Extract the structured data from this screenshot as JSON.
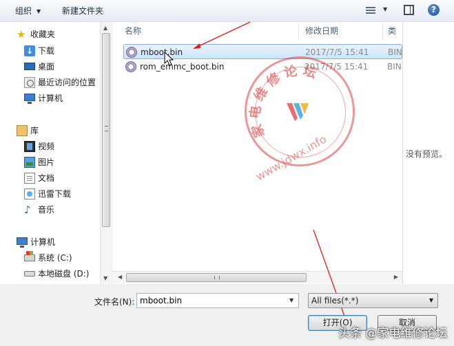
{
  "toolbar": {
    "organize_label": "组织",
    "new_folder_label": "新建文件夹",
    "help_glyph": "?"
  },
  "nav": {
    "favorites": {
      "title": "收藏夹",
      "items": [
        "下载",
        "桌面",
        "最近访问的位置"
      ]
    },
    "computer_group_1": "计算机",
    "libraries": {
      "title": "库",
      "items": [
        "视频",
        "图片",
        "文档",
        "迅雷下载",
        "音乐"
      ]
    },
    "computer": {
      "title": "计算机",
      "items": [
        "系统 (C:)",
        "本地磁盘 (D:)"
      ]
    }
  },
  "file_list": {
    "columns": {
      "name": "名称",
      "date": "修改日期",
      "type": "类型"
    },
    "rows": [
      {
        "name": "mboot.bin",
        "date": "2017/7/5 15:41",
        "type": "BIN"
      },
      {
        "name": "rom_emmc_boot.bin",
        "date": "2017/7/5 15:41",
        "type": "BIN"
      }
    ]
  },
  "preview": {
    "message": "没有预览。"
  },
  "bottom": {
    "filename_label": "文件名(N):",
    "filename_value": "mboot.bin",
    "filter_value": "All files(*.*)",
    "open_label": "打开(O)",
    "cancel_label": "取消"
  },
  "watermark": {
    "circle_text": "家电维修论坛",
    "url": "www.jdwx.info",
    "bottom_caption": "头条 @家电维修论坛"
  },
  "colors": {
    "annotation_arrow": "#e31c1c",
    "selection": "#cfe4fb",
    "watermark": "#d93f3f"
  }
}
